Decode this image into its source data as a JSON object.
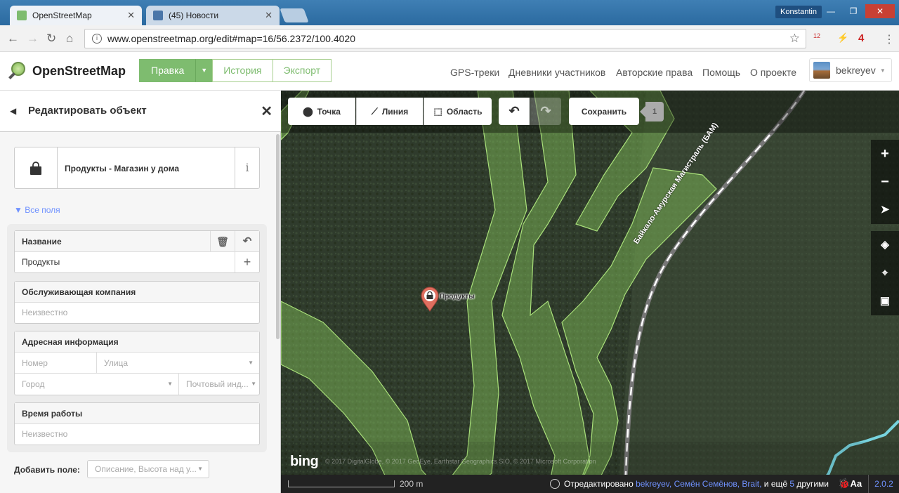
{
  "browser": {
    "tabs": [
      {
        "label": "OpenStreetMap",
        "active": true
      },
      {
        "label": "(45) Новости",
        "active": false
      }
    ],
    "window_user": "Konstantin",
    "url": "www.openstreetmap.org/edit#map=16/56.2372/100.4020",
    "ext_badge": "12",
    "ext_counter": "4"
  },
  "osm_header": {
    "logo_text": "OpenStreetMap",
    "edit_label": "Правка",
    "history_label": "История",
    "export_label": "Экспорт",
    "nav": [
      "GPS-треки",
      "Дневники участников",
      "Авторские права",
      "Помощь",
      "О проекте"
    ],
    "username": "bekreyev"
  },
  "sidebar": {
    "title": "Редактировать объект",
    "preset_name": "Продукты - Магазин у дома",
    "all_fields": "Все поля",
    "fields": {
      "name_label": "Название",
      "name_value": "Продукты",
      "operator_label": "Обслуживающая компания",
      "operator_placeholder": "Неизвестно",
      "address_label": "Адресная информация",
      "address_housenumber": "Номер",
      "address_street": "Улица",
      "address_city": "Город",
      "address_postcode": "Почтовый инд...",
      "hours_label": "Время работы",
      "hours_placeholder": "Неизвестно"
    },
    "add_field_label": "Добавить поле:",
    "add_field_placeholder": "Описание, Высота над у..."
  },
  "toolbar": {
    "point": "Точка",
    "line": "Линия",
    "area": "Область",
    "save": "Сохранить",
    "changes_count": "1"
  },
  "map": {
    "poi_label": "Продукты",
    "road_label": "Байкало-Амурская Магистраль (БАМ)",
    "bing": "bing",
    "imagery_attribution": "© 2017 DigitalGlobe, © 2017 GeoEye, Earthstar Geographics SIO, © 2017 Microsoft Corporation",
    "scale_label": "200 m"
  },
  "footer": {
    "edited_by_prefix": "Отредактировано",
    "contributors": [
      "bekreyev,",
      "Семён Семёнов,",
      "Brait,"
    ],
    "and_more_prefix": "и ещё",
    "more_count": "5",
    "and_more_suffix": "другими",
    "version": "2.0.2"
  },
  "colors": {
    "osm_green": "#7ebc6f",
    "link_blue": "#7092ff",
    "pin_red": "#e06e5f",
    "forest_overlay": "#8cd05f"
  }
}
